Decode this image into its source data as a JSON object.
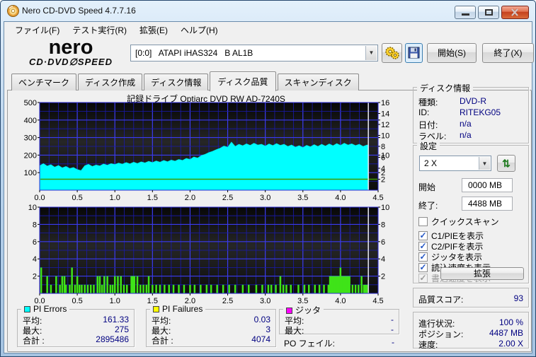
{
  "window": {
    "title": "Nero CD-DVD Speed 4.7.7.16"
  },
  "menu": {
    "items": [
      {
        "name": "file",
        "label": "ファイル(F)"
      },
      {
        "name": "run-test",
        "label": "テスト実行(R)"
      },
      {
        "name": "extra",
        "label": "拡張(E)"
      },
      {
        "name": "help",
        "label": "ヘルプ(H)"
      }
    ]
  },
  "toolbar": {
    "logo": {
      "brand": "nero",
      "product": "CD·DVD∅SPEED"
    },
    "drive_select": "[0:0]   ATAPI iHAS324   B AL1B",
    "start_button": "開始(S)",
    "exit_button": "終了(X)"
  },
  "tabs": {
    "items": [
      {
        "name": "benchmark",
        "label": "ベンチマーク",
        "active": false
      },
      {
        "name": "disc-create",
        "label": "ディスク作成",
        "active": false
      },
      {
        "name": "disc-info",
        "label": "ディスク情報",
        "active": false
      },
      {
        "name": "disc-quality",
        "label": "ディスク品質",
        "active": true
      },
      {
        "name": "scandisc",
        "label": "スキャンディスク",
        "active": false
      }
    ]
  },
  "chart_data": {
    "type": "area+bar",
    "title": "記録ドライブ Optiarc  DVD RW AD-7240S",
    "x_range": [
      0,
      4.5
    ],
    "x_tick_step": 0.5,
    "x_tick_labels": [
      "0.0",
      "0.5",
      "1.0",
      "1.5",
      "2.0",
      "2.5",
      "3.0",
      "3.5",
      "4.0",
      "4.5"
    ],
    "cursor_x": 4.37,
    "grid": {
      "minor_color": "#1a1aae",
      "major_color": "#3b3bf0",
      "x_minor_step": 0.125
    },
    "bg_colors": [
      "#070707",
      "#262626",
      "#0d0d0d"
    ],
    "cursor_color": "#ebebeb",
    "pi_errors": {
      "type": "area",
      "name": "PI Errors",
      "color": "#00ffff",
      "y_left": {
        "max": 500,
        "ticks": [
          100,
          200,
          300,
          400,
          500
        ],
        "minor_step": 50
      },
      "y_right": {
        "max": 16,
        "ticks": [
          2,
          4,
          6,
          8,
          10,
          12,
          14,
          16
        ]
      },
      "read_speed_line": {
        "value_on_right_axis": 2,
        "color": "#3f9b00"
      },
      "sample_dx": 0.05,
      "samples": [
        140,
        152,
        138,
        146,
        132,
        141,
        128,
        136,
        124,
        130,
        118,
        112,
        140,
        148,
        136,
        144,
        139,
        150,
        143,
        152,
        147,
        155,
        149,
        158,
        151,
        160,
        153,
        162,
        156,
        165,
        158,
        167,
        160,
        170,
        163,
        172,
        166,
        176,
        170,
        182,
        176,
        190,
        184,
        198,
        205,
        215,
        222,
        232,
        240,
        252,
        246,
        275,
        250,
        262,
        254,
        265,
        256,
        268,
        258,
        262,
        252,
        264,
        255,
        266,
        256,
        262,
        250,
        258,
        246,
        254,
        244,
        256,
        248,
        260,
        250,
        262,
        252,
        264,
        254,
        266,
        256,
        268,
        258,
        265,
        255,
        262,
        250,
        258
      ]
    },
    "pi_failures": {
      "type": "bar",
      "name": "PI Failures",
      "color": "#3fe318",
      "y_left": {
        "max": 10,
        "ticks": [
          2,
          4,
          6,
          8,
          10
        ],
        "minor_step": 1
      },
      "bars": [
        [
          0.02,
          3
        ],
        [
          0.1,
          2
        ],
        [
          0.15,
          1
        ],
        [
          0.22,
          2
        ],
        [
          0.27,
          1
        ],
        [
          0.3,
          2
        ],
        [
          0.33,
          2
        ],
        [
          0.35,
          1
        ],
        [
          0.4,
          1
        ],
        [
          0.43,
          3
        ],
        [
          0.47,
          1
        ],
        [
          0.5,
          2
        ],
        [
          0.53,
          1
        ],
        [
          0.56,
          1
        ],
        [
          0.6,
          1
        ],
        [
          0.64,
          1
        ],
        [
          0.68,
          1
        ],
        [
          0.72,
          1
        ],
        [
          0.77,
          2
        ],
        [
          0.8,
          2
        ],
        [
          0.83,
          1
        ],
        [
          0.86,
          2
        ],
        [
          0.9,
          2
        ],
        [
          0.94,
          1
        ],
        [
          0.97,
          1
        ],
        [
          1.0,
          2
        ],
        [
          1.04,
          2
        ],
        [
          1.08,
          2
        ],
        [
          1.12,
          1
        ],
        [
          1.16,
          1
        ],
        [
          1.22,
          2
        ],
        [
          1.24,
          2
        ],
        [
          1.26,
          2
        ],
        [
          1.3,
          2
        ],
        [
          1.34,
          1
        ],
        [
          1.38,
          1
        ],
        [
          1.42,
          1
        ],
        [
          1.45,
          2
        ],
        [
          1.5,
          1
        ],
        [
          1.55,
          1
        ],
        [
          1.6,
          1
        ],
        [
          1.66,
          1
        ],
        [
          1.72,
          1
        ],
        [
          1.78,
          1
        ],
        [
          1.85,
          1
        ],
        [
          1.92,
          1
        ],
        [
          2.0,
          1
        ],
        [
          2.06,
          1
        ],
        [
          2.14,
          1
        ],
        [
          2.22,
          1
        ],
        [
          2.28,
          1
        ],
        [
          2.36,
          1
        ],
        [
          2.44,
          1
        ],
        [
          2.52,
          1
        ],
        [
          2.6,
          1
        ],
        [
          2.7,
          1
        ],
        [
          2.78,
          1
        ],
        [
          2.88,
          1
        ],
        [
          2.96,
          1
        ],
        [
          3.04,
          1
        ],
        [
          3.08,
          1
        ],
        [
          3.14,
          1
        ],
        [
          3.2,
          2
        ],
        [
          3.24,
          1
        ],
        [
          3.28,
          1
        ],
        [
          3.34,
          1
        ],
        [
          3.44,
          1
        ],
        [
          3.52,
          1
        ],
        [
          3.58,
          1
        ],
        [
          3.66,
          1
        ],
        [
          3.72,
          1
        ],
        [
          3.78,
          1
        ],
        [
          3.84,
          1
        ],
        [
          3.86,
          2
        ],
        [
          3.88,
          2
        ],
        [
          3.9,
          2
        ],
        [
          3.92,
          2
        ],
        [
          3.94,
          2
        ],
        [
          3.96,
          2
        ],
        [
          3.98,
          2
        ],
        [
          4.0,
          3
        ],
        [
          4.02,
          2
        ],
        [
          4.04,
          2
        ],
        [
          4.06,
          2
        ],
        [
          4.08,
          2
        ],
        [
          4.1,
          2
        ],
        [
          4.12,
          2
        ],
        [
          4.16,
          1
        ],
        [
          4.2,
          1
        ],
        [
          4.24,
          1
        ],
        [
          4.28,
          2
        ],
        [
          4.31,
          1
        ],
        [
          4.33,
          1
        ],
        [
          4.35,
          1
        ]
      ]
    }
  },
  "disc_info": {
    "title": "ディスク情報",
    "rows": [
      {
        "label": "種類:",
        "value": "DVD-R"
      },
      {
        "label": "ID:",
        "value": "RITEKG05"
      },
      {
        "label": "日付:",
        "value": "n/a"
      },
      {
        "label": "ラベル:",
        "value": "n/a"
      }
    ]
  },
  "settings": {
    "title": "設定",
    "speed_select": "2 X",
    "refresh_glyph": "⇅",
    "start_label": "開始",
    "start_value": "0000 MB",
    "end_label": "終了:",
    "end_value": "4488 MB",
    "check_glyph": "✓",
    "checkboxes": [
      {
        "name": "quick-scan",
        "label": "クイックスキャン",
        "checked": false,
        "disabled": false
      },
      {
        "name": "show-c1-pie",
        "label": "C1/PIEを表示",
        "checked": true,
        "disabled": false
      },
      {
        "name": "show-c2-pif",
        "label": "C2/PIFを表示",
        "checked": true,
        "disabled": false
      },
      {
        "name": "show-jitter",
        "label": "ジッタを表示",
        "checked": true,
        "disabled": false
      },
      {
        "name": "show-read-speed",
        "label": "読込速度を表示",
        "checked": true,
        "disabled": false
      },
      {
        "name": "show-write-speed",
        "label": "書込速度を表示",
        "checked": true,
        "disabled": true
      }
    ],
    "advanced_button": "拡張"
  },
  "quality": {
    "label": "品質スコア:",
    "value": "93"
  },
  "progress": {
    "rows": [
      {
        "label": "進行状況:",
        "value": "100 %"
      },
      {
        "label": "ポジション:",
        "value": "4487 MB"
      },
      {
        "label": "速度:",
        "value": "2.00 X"
      }
    ]
  },
  "stats": {
    "pi_errors": {
      "title": "PI Errors",
      "legend_color": "#00ffff",
      "rows": [
        {
          "label": "平均:",
          "value": "161.33"
        },
        {
          "label": "最大:",
          "value": "275"
        },
        {
          "label": "合計 :",
          "value": "2895486"
        }
      ]
    },
    "pi_failures": {
      "title": "PI Failures",
      "legend_color": "#ffff00",
      "rows": [
        {
          "label": "平均:",
          "value": "0.03"
        },
        {
          "label": "最大:",
          "value": "3"
        },
        {
          "label": "合計 :",
          "value": "4074"
        }
      ]
    },
    "jitter": {
      "title": "ジッタ",
      "legend_color": "#ff00ff",
      "rows": [
        {
          "label": "平均:",
          "value": "-"
        },
        {
          "label": "最大:",
          "value": "-"
        }
      ],
      "po_label": "PO フェイル:",
      "po_value": "-"
    }
  }
}
